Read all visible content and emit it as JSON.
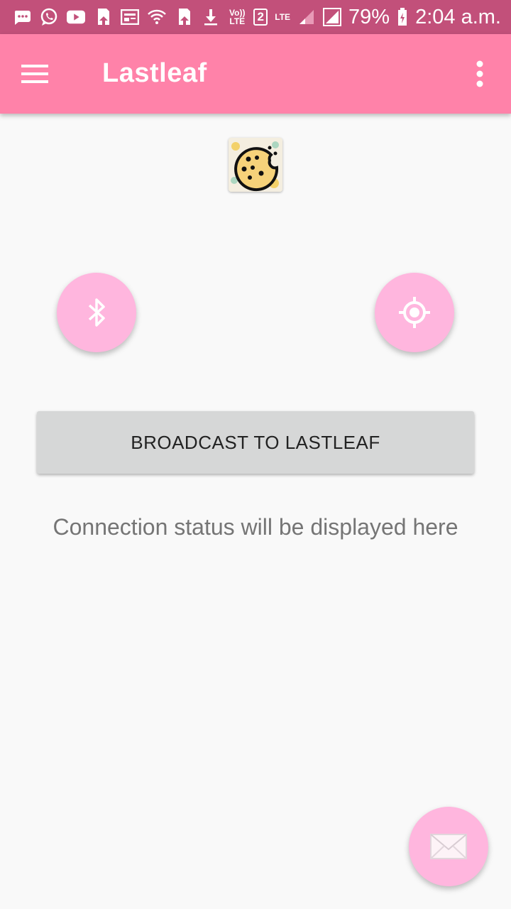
{
  "status_bar": {
    "network": "Vo)) LTE",
    "sim": "2",
    "lte_label": "LTE",
    "battery": "79%",
    "time": "2:04 a.m."
  },
  "app_bar": {
    "title": "Lastleaf"
  },
  "main": {
    "broadcast_label": "BROADCAST TO LASTLEAF",
    "connection_status": "Connection status will be displayed here"
  },
  "icons": {
    "menu": "hamburger-menu-icon",
    "overflow": "more-vert-icon",
    "bluetooth": "bluetooth-icon",
    "location": "gps-fixed-icon",
    "mail": "envelope-icon",
    "logo": "cookie-logo"
  },
  "colors": {
    "status_bar": "#c2507a",
    "app_bar": "#ff82a9",
    "fab": "#ffb6de",
    "button": "#d6d7d7"
  }
}
